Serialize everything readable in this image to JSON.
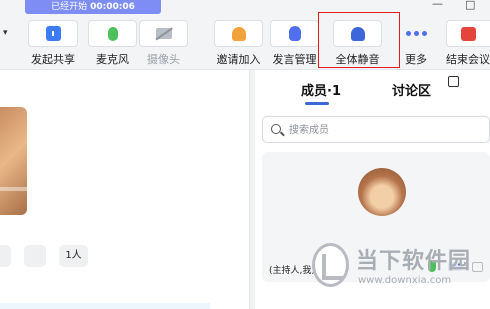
{
  "meeting": {
    "status_label": "已经开始",
    "elapsed": "00:00:06"
  },
  "window": {
    "minimize_glyph": "—",
    "maximize_glyph": "□"
  },
  "toolbar": {
    "collapse_glyph": "▾",
    "share_label": "发起共享",
    "mic_label": "麦克风",
    "camera_label": "摄像头",
    "invite_label": "邀请加入",
    "speech_mgmt_label": "发言管理",
    "mute_all_label": "全体静音",
    "more_label": "更多",
    "end_label": "结束会议"
  },
  "video_area": {
    "participant_count": "1人"
  },
  "panel": {
    "tabs": [
      {
        "label": "成员·1",
        "active": true
      },
      {
        "label": "讨论区",
        "active": false
      }
    ],
    "search_placeholder": "搜索成员",
    "members": [
      {
        "name": "(主持人,我)倪钟",
        "mic_on": true
      }
    ],
    "more_glyph": "•••"
  },
  "watermark": {
    "title": "当下软件园",
    "url": "www.downxia.com"
  },
  "colors": {
    "accent": "#3d67d8",
    "timer_bg": "#7d8df4",
    "mic_green": "#4cc15a",
    "end_red": "#e5443d",
    "highlight_red": "#e31b1b"
  },
  "icons": [
    "share-icon",
    "microphone-icon",
    "camera-off-icon",
    "invite-icon",
    "raise-hand-icon",
    "mute-all-icon",
    "more-dots-icon",
    "end-meeting-icon",
    "search-icon",
    "popout-icon"
  ]
}
